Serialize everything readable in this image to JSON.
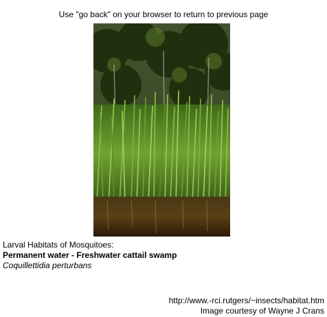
{
  "top_note": "Use \"go back\" on your browser to return to previous page",
  "caption": {
    "line1": "Larval Habitats of Mosquitoes:",
    "line2": "Permanent water - Freshwater cattail swamp",
    "line3": "Coquillettidia perturbans"
  },
  "credit": {
    "url": "http://www.-rci.rutgers/~insects/habitat.htm",
    "courtesy": "Image courtesy of Wayne J Crans"
  },
  "photo": {
    "colors": {
      "sky": "#b7c9a6",
      "trees": "#2f3a16",
      "reeds": "#5c8f2b",
      "reeds_light": "#8fbf45",
      "water": "#3a2a10"
    }
  }
}
